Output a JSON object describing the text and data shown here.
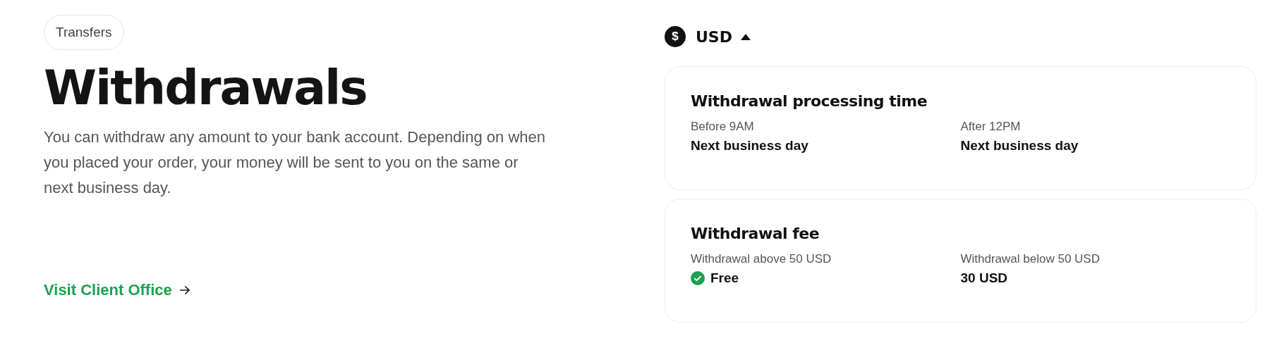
{
  "tag": "Transfers",
  "title": "Withdrawals",
  "description": "You can withdraw any amount to your bank account. Depending on when you placed your order, your money will be sent to you on the same or next business day.",
  "link": "Visit Client Office",
  "currency": {
    "symbol": "$",
    "code": "USD"
  },
  "cards": [
    {
      "title": "Withdrawal processing time",
      "items": [
        {
          "label": "Before 9AM",
          "value": "Next business day",
          "kind": "text"
        },
        {
          "label": "After 12PM",
          "value": "Next business day",
          "kind": "text"
        }
      ]
    },
    {
      "title": "Withdrawal fee",
      "items": [
        {
          "label": "Withdrawal above 50 USD",
          "value": "Free",
          "kind": "check"
        },
        {
          "label": "Withdrawal below 50 USD",
          "value": "30 USD",
          "kind": "text"
        }
      ]
    }
  ]
}
